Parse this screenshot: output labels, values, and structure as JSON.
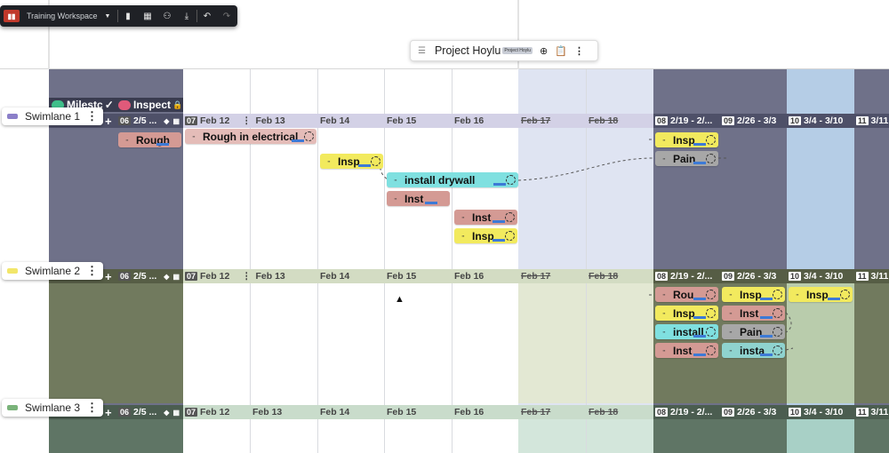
{
  "toolbar": {
    "workspace_label": "Training Workspace",
    "icons": [
      "app-logo",
      "bookmark-icon",
      "grid-icon",
      "share-icon",
      "download-icon",
      "undo-icon",
      "redo-icon"
    ]
  },
  "title": {
    "text": "Project Hoylu",
    "badge": "Project Hoylu"
  },
  "milestones": {
    "label": "Milestc",
    "inspect_label": "Inspect"
  },
  "columns": {
    "week06": "2/5 ...",
    "week06_num": "06",
    "week07_num": "07",
    "days": [
      "Feb 12",
      "Feb 13",
      "Feb 14",
      "Feb 15",
      "Feb 16",
      "Feb 17",
      "Feb 18"
    ],
    "weeks": [
      {
        "num": "08",
        "label": "2/19 - 2/..."
      },
      {
        "num": "09",
        "label": "2/26 - 3/3"
      },
      {
        "num": "10",
        "label": "3/4 - 3/10"
      },
      {
        "num": "11",
        "label": "3/11"
      }
    ],
    "week08_lane1": "2/19 - 2/...",
    "week08_lane2": "2/19 - 2/..."
  },
  "swimlanes": [
    {
      "name": "Swimlane 1",
      "color": "#8b7fc9"
    },
    {
      "name": "Swimlane 2",
      "color": "#f2e66a"
    },
    {
      "name": "Swimlane 3",
      "color": "#7ab37a"
    }
  ],
  "cards": {
    "l1_rough": "Rough",
    "l1_rough_elec": "Rough in electrical",
    "l1_insp1": "Insp",
    "l1_drywall": "install drywall",
    "l1_inst1": "Inst",
    "l1_inst2": "Inst",
    "l1_insp2": "Insp",
    "l1_w8_insp": "Insp",
    "l1_w8_pain": "Pain",
    "l2_rou": "Rou",
    "l2_insp": "Insp",
    "l2_install": "install",
    "l2_inst": "Inst",
    "l2_w9_insp": "Insp",
    "l2_w9_inst": "Inst",
    "l2_w9_pain": "Pain",
    "l2_w9_insta": "insta",
    "l2_w10_insp": "Insp"
  },
  "colors": {
    "lane1_band": "#d3d1e6",
    "lane2_band": "#d3dcc3",
    "lane3_band": "#c9dccb",
    "card_red": "#d49a94",
    "card_yellow": "#f2ea5e",
    "card_cyan": "#7fe0e0",
    "card_gray": "#9a9a9a"
  }
}
